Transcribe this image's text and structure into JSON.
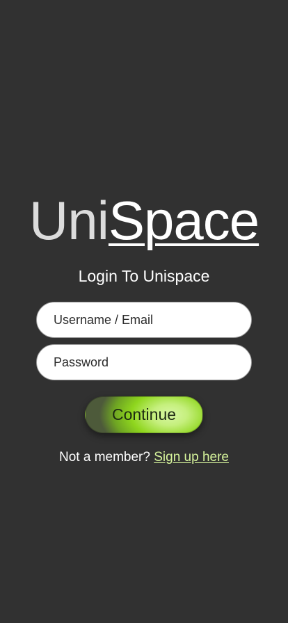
{
  "logo": {
    "part1": "Uni",
    "part2": "Space"
  },
  "subtitle": "Login To Unispace",
  "form": {
    "username_placeholder": "Username / Email",
    "password_placeholder": "Password",
    "continue_label": "Continue"
  },
  "signup": {
    "prompt": "Not a member?",
    "link_label": "Sign up here"
  },
  "colors": {
    "background": "#313131",
    "accent_green": "#a6e22e",
    "link": "#d7f59c"
  }
}
